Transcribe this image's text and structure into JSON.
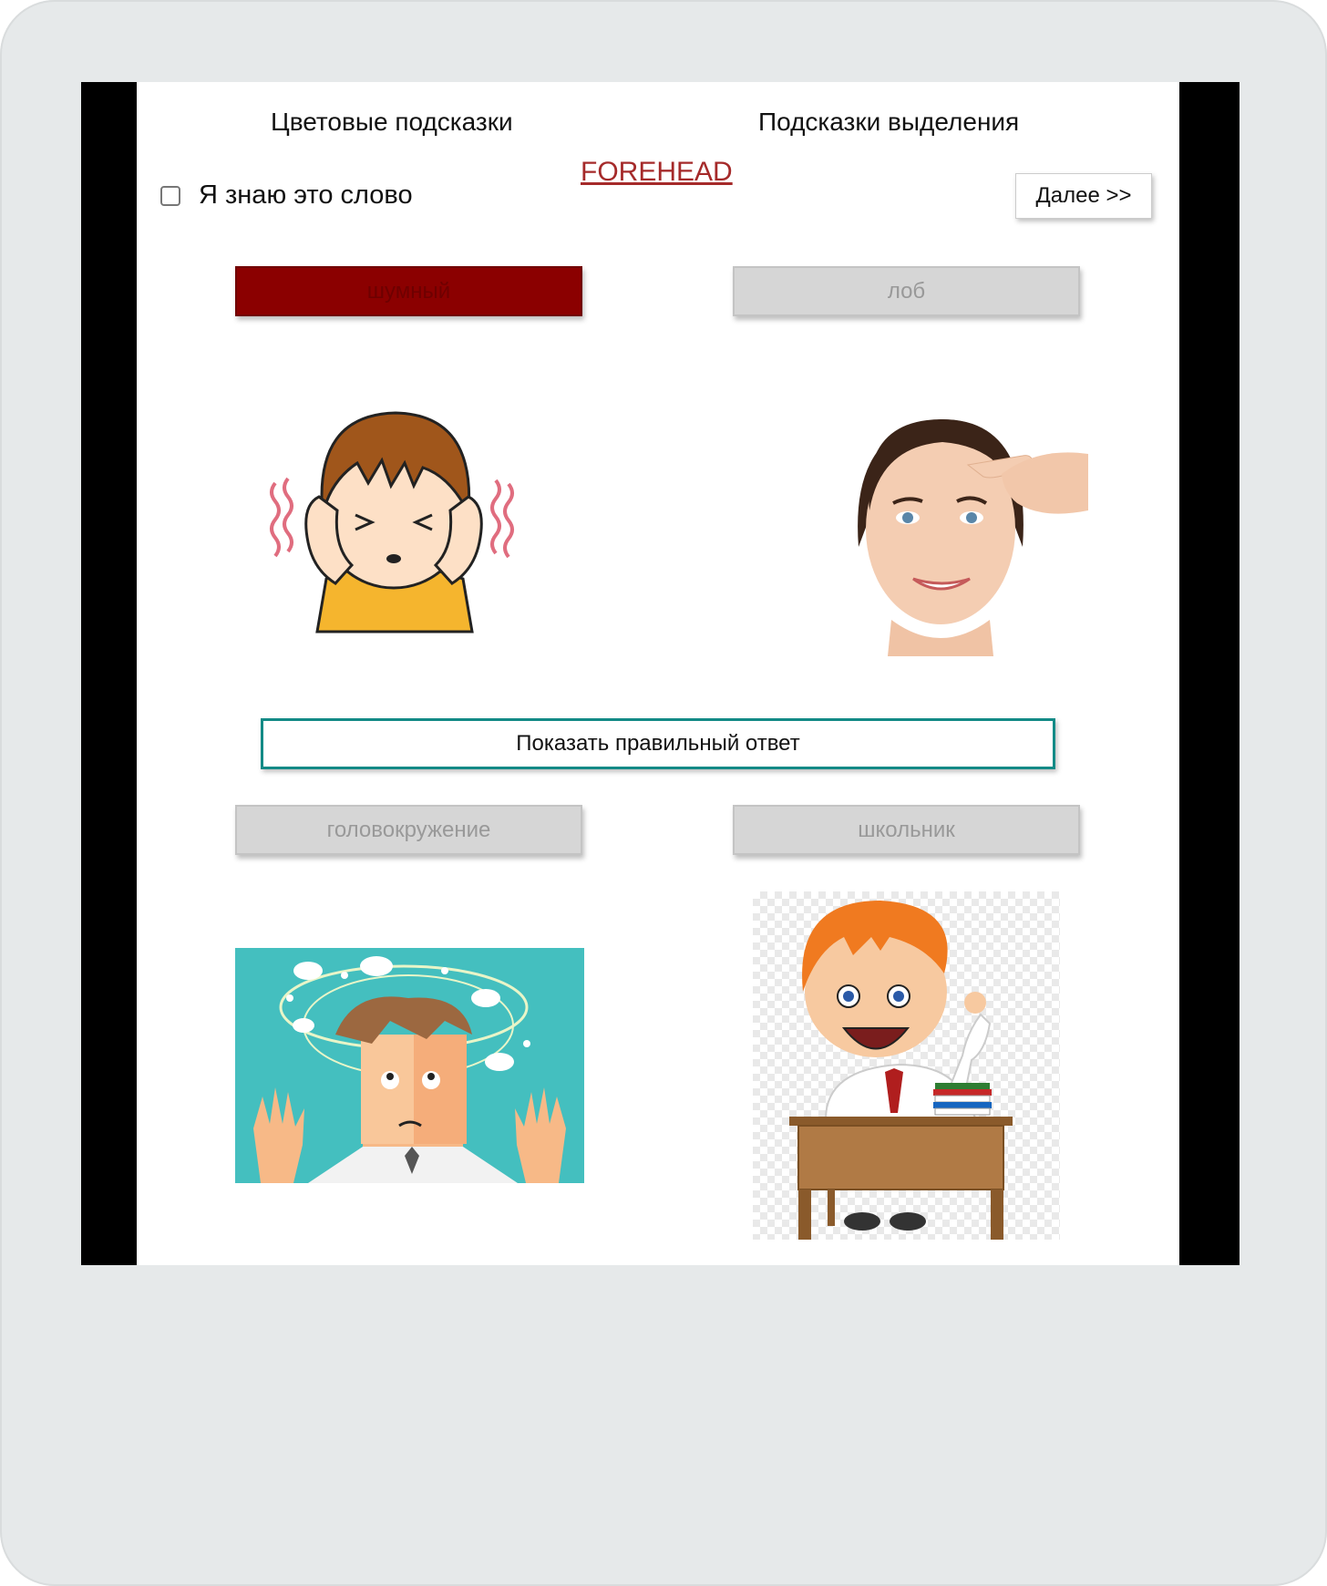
{
  "header": {
    "color_hints": "Цветовые подсказки",
    "highlight_hints": "Подсказки выделения"
  },
  "word": "FOREHEAD",
  "know_word": {
    "label": "Я знаю это слово",
    "checked": false
  },
  "next_button": "Далее >>",
  "options": [
    {
      "label": "шумный",
      "selected": true,
      "image": "boy-covering-ears"
    },
    {
      "label": "лоб",
      "selected": false,
      "image": "woman-pointing-forehead"
    },
    {
      "label": "головокружение",
      "selected": false,
      "image": "dizzy-man-birds"
    },
    {
      "label": "школьник",
      "selected": false,
      "image": "schoolboy-at-desk"
    }
  ],
  "show_answer_button": "Показать правильный ответ",
  "colors": {
    "selected_option": "#8b0000",
    "word_link": "#a52a2a",
    "show_answer_border": "#138a86",
    "option_inactive": "#d6d6d6"
  }
}
